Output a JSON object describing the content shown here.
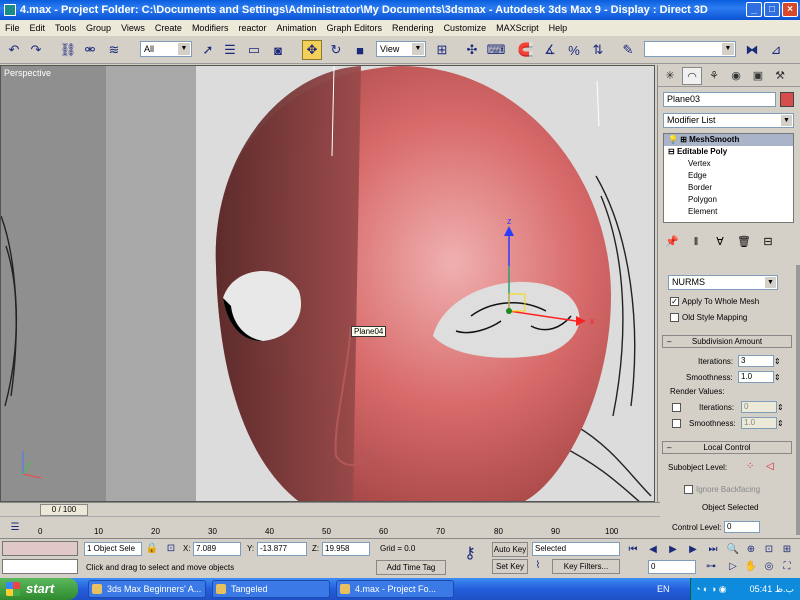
{
  "window": {
    "title": "4.max     - Project Folder: C:\\Documents and Settings\\Administrator\\My Documents\\3dsmax     - Autodesk 3ds Max 9        - Display : Direct 3D"
  },
  "menu": [
    "File",
    "Edit",
    "Tools",
    "Group",
    "Views",
    "Create",
    "Modifiers",
    "reactor",
    "Animation",
    "Graph Editors",
    "Rendering",
    "Customize",
    "MAXScript",
    "Help"
  ],
  "toolbar": {
    "selection_filter": "All",
    "reference_coord": "View"
  },
  "viewport": {
    "label": "Perspective",
    "object_tag": "Plane04",
    "axis_z": "z",
    "axis_x": "x",
    "axis_y": "y"
  },
  "command_panel": {
    "object_name": "Plane03",
    "modifier_list": "Modifier List",
    "stack": [
      {
        "label": "MeshSmooth",
        "kind": "sel"
      },
      {
        "label": "Editable Poly",
        "kind": "bold"
      },
      {
        "label": "Vertex",
        "kind": "sub"
      },
      {
        "label": "Edge",
        "kind": "sub"
      },
      {
        "label": "Border",
        "kind": "sub"
      },
      {
        "label": "Polygon",
        "kind": "sub"
      },
      {
        "label": "Element",
        "kind": "sub"
      }
    ],
    "subdivision_method": "NURMS",
    "apply_whole_mesh": "Apply To Whole Mesh",
    "old_style_mapping": "Old Style Mapping",
    "rollout_subdivision": "Subdivision Amount",
    "iterations_label": "Iterations:",
    "iterations": "3",
    "smoothness_label": "Smoothness:",
    "smoothness": "1.0",
    "render_values": "Render Values:",
    "render_iterations": "0",
    "render_smoothness": "1.0",
    "rollout_local": "Local Control",
    "subobject_level": "Subobject Level:",
    "ignore_backfacing": "Ignore Backfacing",
    "object_selected": "Object Selected",
    "control_level_label": "Control Level:",
    "control_level": "0"
  },
  "timeline": {
    "slider": "0 / 100",
    "ticks": [
      "0",
      "10",
      "20",
      "30",
      "40",
      "50",
      "60",
      "70",
      "80",
      "90",
      "100"
    ]
  },
  "status": {
    "selection": "1 Object Sele",
    "x_label": "X:",
    "x": "7.089",
    "y_label": "Y:",
    "y": "-13.877",
    "z_label": "Z:",
    "z": "19.958",
    "grid": "Grid = 0.0",
    "prompt": "Click and drag to select and move objects",
    "add_time_tag": "Add Time Tag",
    "auto_key": "Auto Key",
    "set_key": "Set Key",
    "key_mode": "Selected",
    "key_filters": "Key Filters...",
    "frame": "0"
  },
  "taskbar": {
    "start": "start",
    "tasks": [
      {
        "label": "3ds Max Beginners' A..."
      },
      {
        "label": "Tangeled"
      },
      {
        "label": "4.max - Project Fo..."
      }
    ],
    "lang": "EN",
    "clock": "05:41 ب.ظ"
  }
}
